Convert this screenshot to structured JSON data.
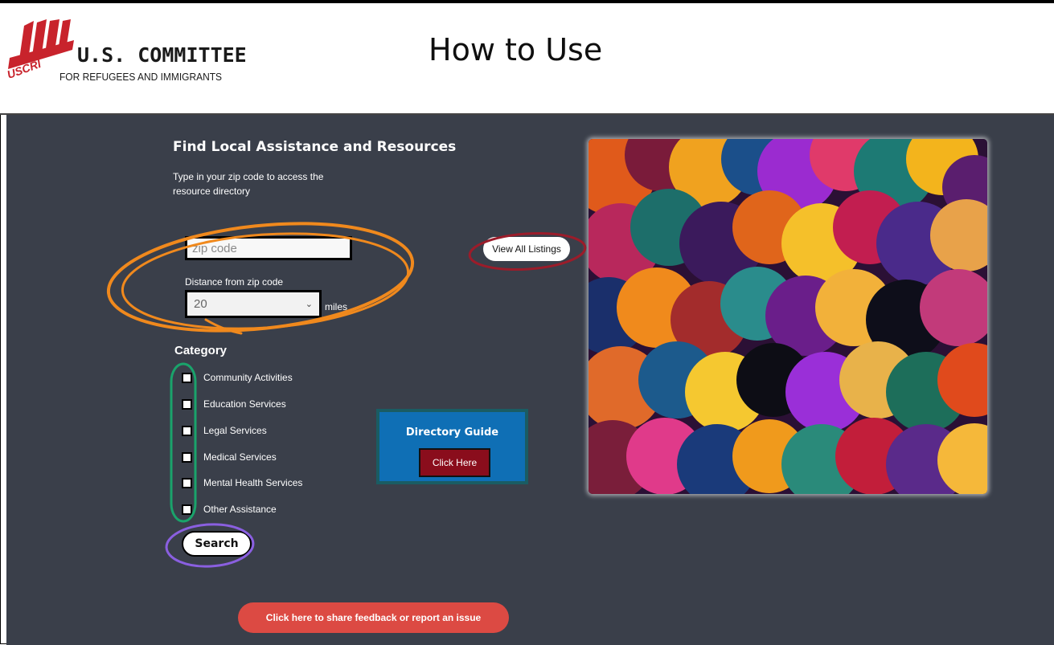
{
  "header": {
    "logo_line1": "U.S. COMMITTEE",
    "logo_line2": "FOR REFUGEES AND IMMIGRANTS",
    "logo_badge": "USCRI",
    "title": "How to Use"
  },
  "search_panel": {
    "heading": "Find Local Assistance and Resources",
    "intro": "Type in your zip code to access the resource directory",
    "zip_placeholder": "zip code",
    "distance_label": "Distance from zip code",
    "distance_value": "20",
    "distance_unit": "miles",
    "view_all_label": "View All Listings",
    "category_heading": "Category",
    "categories": [
      {
        "label": "Community Activities",
        "checked": false
      },
      {
        "label": "Education Services",
        "checked": false
      },
      {
        "label": "Legal Services",
        "checked": false
      },
      {
        "label": "Medical Services",
        "checked": false
      },
      {
        "label": "Mental Health Services",
        "checked": false
      },
      {
        "label": "Other Assistance",
        "checked": false
      }
    ],
    "search_label": "Search"
  },
  "directory_guide": {
    "title": "Directory Guide",
    "button_label": "Click Here"
  },
  "feedback": {
    "label": "Click here to share feedback or report an issue"
  },
  "colors": {
    "background": "#3a3f4a",
    "feedback_button": "#dc4a43",
    "guide_box": "#0f6fb5",
    "guide_button": "#8a0d1c",
    "annotation_orange": "#f0891d",
    "annotation_red": "#9b1c2a",
    "annotation_green": "#1aa36b",
    "annotation_purple": "#8a5fe0"
  }
}
